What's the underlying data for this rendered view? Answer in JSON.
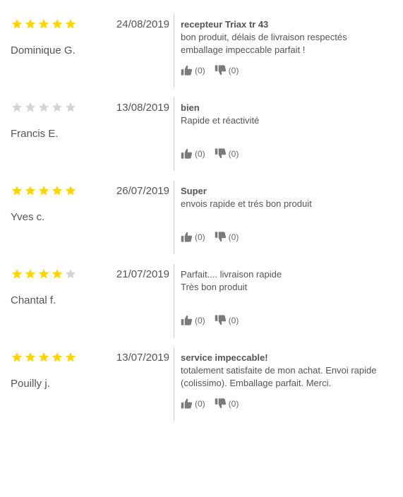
{
  "colors": {
    "star_filled": "#ffd400",
    "star_empty": "#d4d4d4",
    "thumb": "#7a7a7a",
    "divider": "#cccccc"
  },
  "reviews": [
    {
      "rating": 5,
      "date": "24/08/2019",
      "author": "Dominique G.",
      "title": "recepteur Triax tr 43",
      "text": "bon produit, délais de livraison respectés\nemballage impeccable parfait !",
      "upvotes": "(0)",
      "downvotes": "(0)"
    },
    {
      "rating": 0,
      "date": "13/08/2019",
      "author": "Francis E.",
      "title": "bien",
      "text": "Rapide et réactivité",
      "upvotes": "(0)",
      "downvotes": "(0)"
    },
    {
      "rating": 5,
      "date": "26/07/2019",
      "author": "Yves c.",
      "title": "Super",
      "text": "envois rapide et trés bon produit",
      "upvotes": "(0)",
      "downvotes": "(0)"
    },
    {
      "rating": 4,
      "date": "21/07/2019",
      "author": "Chantal f.",
      "title": "",
      "text": "Parfait.... livraison rapide\nTrès bon produit",
      "upvotes": "(0)",
      "downvotes": "(0)"
    },
    {
      "rating": 5,
      "date": "13/07/2019",
      "author": "Pouilly j.",
      "title": "service impeccable!",
      "text": "totalement satisfaite de mon achat. Envoi rapide\n(colissimo). Emballage parfait. Merci.",
      "upvotes": "(0)",
      "downvotes": "(0)"
    }
  ]
}
